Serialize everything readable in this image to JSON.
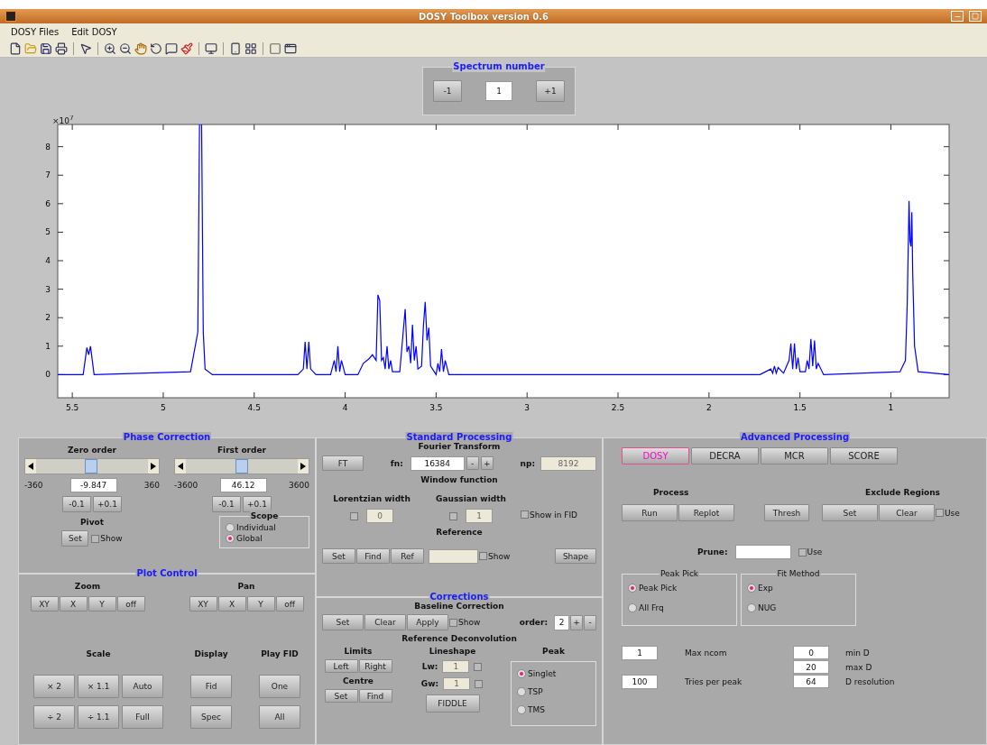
{
  "window": {
    "title": "DOSY Toolbox version 0.6"
  },
  "menu": [
    "DOSY Files",
    "Edit DOSY"
  ],
  "spectrum_number": {
    "title": "Spectrum number",
    "buttons": [
      "-1",
      "+1"
    ],
    "value": "1"
  },
  "plot": {
    "chart_data": {
      "type": "line",
      "xlim": [
        5.58,
        0.68
      ],
      "ylim": [
        -0.81,
        8.78
      ],
      "xticks": [
        5.5,
        5,
        4.5,
        4,
        3.5,
        3,
        2.5,
        2,
        1.5,
        1
      ],
      "yticks": [
        0,
        1,
        2,
        3,
        4,
        5,
        6,
        7,
        8
      ],
      "annotations": [
        {
          "text": "×10$^{7}$"
        }
      ],
      "x": [
        5.58,
        5.44,
        5.42,
        5.41,
        5.4,
        5.38,
        4.85,
        4.81,
        4.8,
        4.79,
        4.78,
        4.77,
        4.73,
        4.26,
        4.23,
        4.22,
        4.21,
        4.2,
        4.19,
        4.16,
        4.08,
        4.06,
        4.05,
        4.04,
        4.03,
        4.02,
        4.0,
        3.93,
        3.9,
        3.87,
        3.85,
        3.83,
        3.82,
        3.81,
        3.8,
        3.79,
        3.78,
        3.77,
        3.76,
        3.75,
        3.74,
        3.7,
        3.67,
        3.66,
        3.65,
        3.64,
        3.63,
        3.62,
        3.61,
        3.6,
        3.58,
        3.57,
        3.56,
        3.55,
        3.54,
        3.53,
        3.5,
        3.49,
        3.48,
        3.47,
        3.46,
        3.45,
        3.43,
        1.72,
        1.66,
        1.65,
        1.64,
        1.63,
        1.62,
        1.59,
        1.56,
        1.55,
        1.54,
        1.53,
        1.52,
        1.51,
        1.5,
        1.47,
        1.46,
        1.45,
        1.44,
        1.43,
        1.42,
        1.41,
        1.4,
        1.37,
        0.95,
        0.92,
        0.91,
        0.9,
        0.895,
        0.89,
        0.885,
        0.88,
        0.87,
        0.85,
        0.68
      ],
      "series": [
        {
          "color": "#0000ff",
          "values": [
            0,
            0,
            0.95,
            0.7,
            1.0,
            0,
            0.1,
            1.5,
            null,
            null,
            1.5,
            0.2,
            0,
            0,
            0.2,
            1.15,
            0.2,
            1.15,
            0.2,
            0,
            0,
            0.5,
            0.1,
            1.0,
            0.1,
            0.5,
            0,
            0,
            0.4,
            0.55,
            0.7,
            0.5,
            2.8,
            2.6,
            0.5,
            0.6,
            0.2,
            1.0,
            0.2,
            0.5,
            0.1,
            0.1,
            2.3,
            0.8,
            1.0,
            0.4,
            1.75,
            0.5,
            1.0,
            0.2,
            0.3,
            1.7,
            2.55,
            1.2,
            1.65,
            0.3,
            0,
            0.4,
            0.1,
            0.9,
            0.1,
            0.5,
            0,
            0,
            0.2,
            0.05,
            0.3,
            0.05,
            0.25,
            0.05,
            0.5,
            1.1,
            0.2,
            1.1,
            0.2,
            0.6,
            0.1,
            0.1,
            0.5,
            0.2,
            1.25,
            0.3,
            1.2,
            0.2,
            0.4,
            0,
            0.1,
            0.5,
            2.5,
            6.1,
            4.7,
            4.5,
            5.7,
            3.5,
            1.0,
            0.1,
            0
          ]
        }
      ]
    }
  },
  "phase_correction": {
    "title": "Phase Correction",
    "sliders": [
      {
        "label": "Zero order",
        "min": "-360",
        "max": "360",
        "value": "-9.847",
        "level": 0.49,
        "steps": [
          "-0.1",
          "+0.1"
        ]
      },
      {
        "label": "First order",
        "min": "-3600",
        "max": "3600",
        "value": "46.12",
        "level": 0.5,
        "steps": [
          "-0.1",
          "+0.1"
        ]
      }
    ],
    "pivot": {
      "label": "Pivot",
      "button": "Set",
      "show": {
        "label": "Show",
        "checked": false
      }
    },
    "scope": {
      "title": "Scope",
      "options": [
        {
          "label": "Individual",
          "selected": false
        },
        {
          "label": "Global",
          "selected": true
        }
      ]
    }
  },
  "plot_control": {
    "title": "Plot Control",
    "zoom": {
      "label": "Zoom",
      "buttons": [
        "XY",
        "X",
        "Y",
        "off"
      ]
    },
    "pan": {
      "label": "Pan",
      "buttons": [
        "XY",
        "X",
        "Y",
        "off"
      ]
    },
    "scale": {
      "label": "Scale",
      "buttons": [
        "× 2",
        "× 1.1",
        "Auto",
        "÷ 2",
        "÷ 1.1",
        "Full"
      ]
    },
    "display": {
      "label": "Display",
      "buttons": [
        "Fid",
        "Spec"
      ]
    },
    "play_fid": {
      "label": "Play FID",
      "buttons": [
        "One",
        "All"
      ]
    }
  },
  "standard_processing": {
    "title": "Standard Processing",
    "fourier": {
      "label": "Fourier Transform",
      "button": "FT",
      "fn_label": "fn:",
      "fn_value": "16384",
      "fn_buttons": [
        "-",
        "+"
      ],
      "np_label": "np:",
      "np_value": "8192",
      "np_disabled": true
    },
    "window_function": {
      "label": "Window function",
      "widths": [
        {
          "label": "Lorentzian width",
          "checked": false,
          "value": "0",
          "disabled": true
        },
        {
          "label": "Gaussian width",
          "checked": false,
          "value": "1",
          "disabled": true
        }
      ],
      "show_in_fid": {
        "label": "Show in FID",
        "checked": false
      }
    },
    "reference": {
      "label": "Reference",
      "buttons": [
        "Set",
        "Find",
        "Ref"
      ],
      "show": {
        "label": "Show",
        "checked": false
      },
      "shape_button": "Shape"
    }
  },
  "corrections": {
    "title": "Corrections",
    "baseline": {
      "label": "Baseline Correction",
      "buttons": [
        "Set",
        "Clear",
        "Apply"
      ],
      "show": {
        "label": "Show",
        "checked": false
      },
      "order_label": "order:",
      "order_value": "2",
      "order_buttons": [
        "+",
        "-"
      ]
    },
    "deconvolution": {
      "label": "Reference Deconvolution",
      "limits": {
        "label": "Limits",
        "buttons": [
          "Left",
          "Right"
        ]
      },
      "centre": {
        "label": "Centre",
        "buttons": [
          "Set",
          "Find"
        ]
      },
      "lineshape": {
        "label": "Lineshape",
        "fields": [
          {
            "label": "Lw:",
            "value": "1",
            "checked": false,
            "disabled": true
          },
          {
            "label": "Gw:",
            "value": "1",
            "checked": false,
            "disabled": true
          }
        ]
      },
      "fiddle_button": "FIDDLE",
      "peak": {
        "label": "Peak",
        "options": [
          {
            "label": "Singlet",
            "selected": true
          },
          {
            "label": "TSP",
            "selected": false
          },
          {
            "label": "TMS",
            "selected": false
          }
        ]
      }
    }
  },
  "advanced_processing": {
    "title": "Advanced Processing",
    "tabs": [
      {
        "label": "DOSY",
        "selected": true
      },
      {
        "label": "DECRA",
        "selected": false
      },
      {
        "label": "MCR",
        "selected": false
      },
      {
        "label": "SCORE",
        "selected": false
      }
    ],
    "process": {
      "label": "Process",
      "buttons": [
        "Run",
        "Replot"
      ]
    },
    "thresh_button": "Thresh",
    "exclude": {
      "label": "Exclude Regions",
      "buttons": [
        "Set",
        "Clear"
      ],
      "use": {
        "label": "Use",
        "checked": false
      }
    },
    "prune": {
      "label": "Prune:",
      "use": {
        "label": "Use",
        "checked": false
      }
    },
    "peak_pick": {
      "title": "Peak Pick",
      "options": [
        {
          "label": "Peak Pick",
          "selected": true
        },
        {
          "label": "All Frq",
          "selected": false
        }
      ]
    },
    "fit_method": {
      "title": "Fit Method",
      "options": [
        {
          "label": "Exp",
          "selected": true
        },
        {
          "label": "NUG",
          "selected": false
        }
      ]
    },
    "left_params": [
      {
        "value": "1",
        "label": "Max ncom"
      },
      {
        "value": "100",
        "label": "Tries per peak"
      }
    ],
    "right_params": [
      {
        "value": "0",
        "label": "min D"
      },
      {
        "value": "20",
        "label": "max D"
      },
      {
        "value": "64",
        "label": "D resolution"
      }
    ]
  }
}
